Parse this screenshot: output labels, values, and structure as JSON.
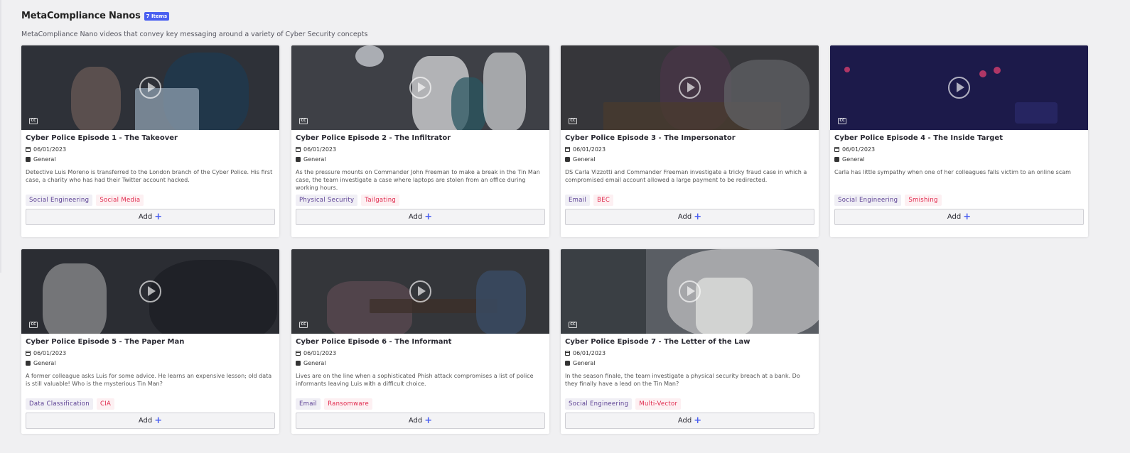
{
  "page": {
    "title": "MetaCompliance Nanos",
    "count_badge": "7 Items",
    "subtitle": "MetaCompliance Nano videos that convey key messaging around a variety of Cyber Security concepts"
  },
  "colors": {
    "accent": "#4a5ff0",
    "topic_tag": "#5b3f93",
    "threat_tag": "#e0264a"
  },
  "cards": [
    {
      "title": "Cyber Police Episode 1 - The Takeover",
      "date": "06/01/2023",
      "category": "General",
      "description": "Detective Luis Moreno is transferred to the London branch of the Cyber Police. His first case, a charity who has had their Twitter account hacked.",
      "tags": [
        "Social Engineering",
        "Social Media"
      ],
      "add_label": "Add",
      "cc_label": "CC",
      "bg": "#2e3138"
    },
    {
      "title": "Cyber Police Episode 2 - The Infiltrator",
      "date": "06/01/2023",
      "category": "General",
      "description": "As the pressure mounts on Commander John Freeman to make a break in the Tin Man case, the team investigate a case where laptops are stolen from an office during working hours.",
      "tags": [
        "Physical Security",
        "Tailgating"
      ],
      "add_label": "Add",
      "cc_label": "CC",
      "bg": "#3e4046"
    },
    {
      "title": "Cyber Police Episode 3 - The Impersonator",
      "date": "06/01/2023",
      "category": "General",
      "description": "DS Carla Vizzotti and Commander Freeman investigate a tricky fraud case in which a compromised email account allowed a large payment to be redirected.",
      "tags": [
        "Email",
        "BEC"
      ],
      "add_label": "Add",
      "cc_label": "CC",
      "bg": "#36363a"
    },
    {
      "title": "Cyber Police Episode 4 - The Inside Target",
      "date": "06/01/2023",
      "category": "General",
      "description": "Carla has little sympathy when one of her colleagues falls victim to an online scam",
      "tags": [
        "Social Engineering",
        "Smishing"
      ],
      "add_label": "Add",
      "cc_label": "CC",
      "bg": "#1c1a4a"
    },
    {
      "title": "Cyber Police Episode 5 - The Paper Man",
      "date": "06/01/2023",
      "category": "General",
      "description": "A former colleague asks Luis for some advice. He learns an expensive lesson; old data is still valuable! Who is the mysterious Tin Man?",
      "tags": [
        "Data Classification",
        "CIA"
      ],
      "add_label": "Add",
      "cc_label": "CC",
      "bg": "#2b2d33"
    },
    {
      "title": "Cyber Police Episode 6 - The Informant",
      "date": "06/01/2023",
      "category": "General",
      "description": "Lives are on the line when a sophisticated Phish attack compromises a list of police informants leaving Luis with a difficult choice.",
      "tags": [
        "Email",
        "Ransomware"
      ],
      "add_label": "Add",
      "cc_label": "CC",
      "bg": "#34363a"
    },
    {
      "title": "Cyber Police Episode 7 - The Letter of the Law",
      "date": "06/01/2023",
      "category": "General",
      "description": "In the season finale, the team investigate a physical security breach at a bank. Do they finally have a lead on the Tin Man?",
      "tags": [
        "Social Engineering",
        "Multi-Vector"
      ],
      "add_label": "Add",
      "cc_label": "CC",
      "bg": "#5a5e64"
    }
  ]
}
